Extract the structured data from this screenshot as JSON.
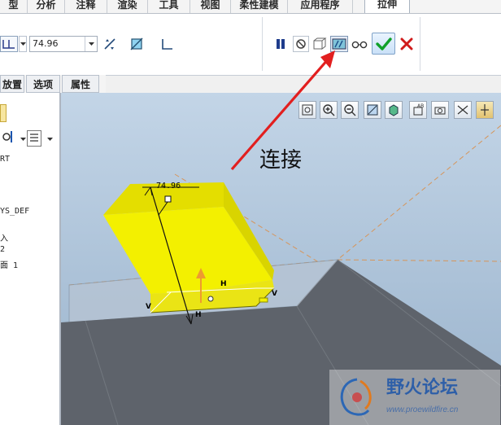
{
  "ribbon_tabs": [
    {
      "label": "模型",
      "visible_label": "型"
    },
    {
      "label": "分析"
    },
    {
      "label": "注释"
    },
    {
      "label": "渲染"
    },
    {
      "label": "工具"
    },
    {
      "label": "视图"
    },
    {
      "label": "柔性建模"
    },
    {
      "label": "应用程序"
    },
    {
      "label": "拉伸"
    }
  ],
  "ribbon": {
    "depth_value": "74.96",
    "pause_icon": "pause-icon",
    "no_preview_icon": "no-preview-icon",
    "preview_icon": "preview-icon",
    "connect_preview_icon": "connect-preview-icon",
    "glasses_icon": "glasses-icon",
    "confirm_icon": "checkmark-icon",
    "cancel_icon": "x-icon"
  },
  "sub_tabs": [
    {
      "label": "放置",
      "visible_label": "放置"
    },
    {
      "label": "选项"
    },
    {
      "label": "属性"
    }
  ],
  "tree": {
    "items": [
      "RT",
      "YS_DEF",
      "入",
      "2",
      "面 1"
    ]
  },
  "viewport": {
    "dimension_label": "74.96",
    "annotation": "连接",
    "marker_h1": "H",
    "marker_h2": "H",
    "marker_v1": "V",
    "marker_v2": "V"
  },
  "watermark": {
    "title": "野火论坛",
    "url": "www.proewildfire.cn"
  },
  "colors": {
    "accent_red": "#e21f1f",
    "yellow_body": "#f3f000",
    "dark_gray": "#5e636b"
  }
}
